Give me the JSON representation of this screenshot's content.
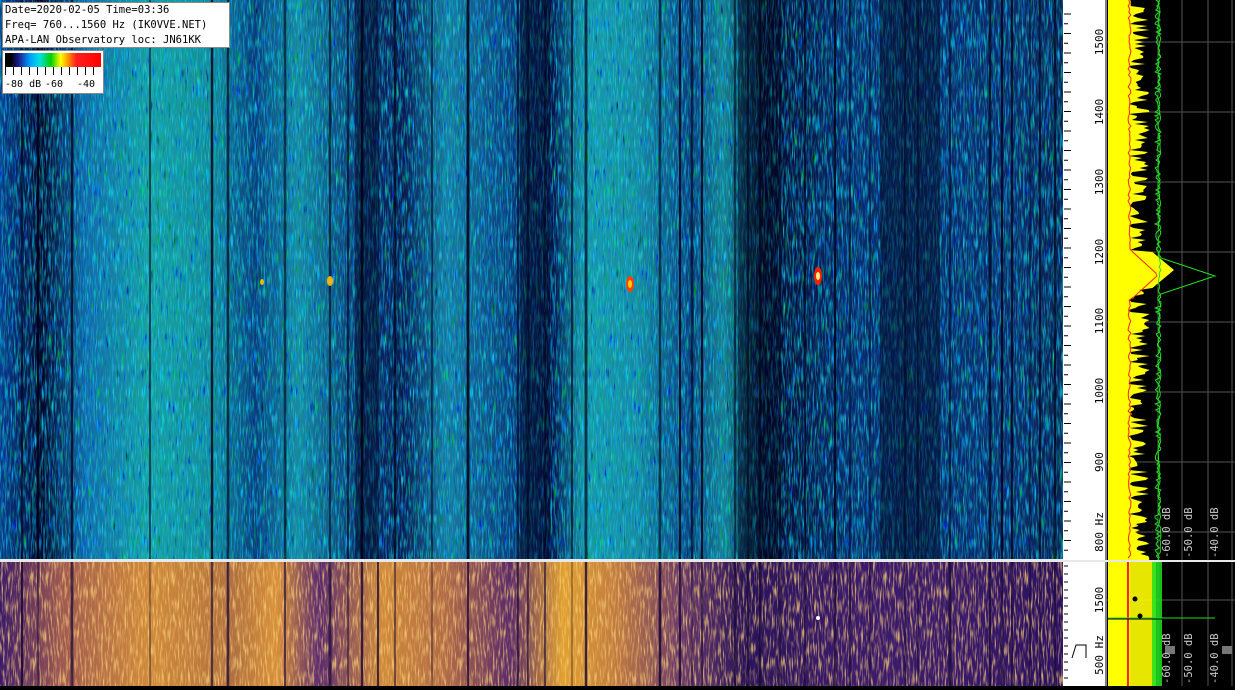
{
  "info": {
    "date_line": "Date=2020-02-05 Time=03:36",
    "freq_line": "Freq= 760...1560 Hz (IK0VVE.NET)",
    "location_line": "APA-LAN Observatory loc: JN61KK"
  },
  "colorbar": {
    "labels": [
      "-80 dB",
      "-60",
      "-40"
    ]
  },
  "main_axis": {
    "ticks": [
      "1500",
      "1400",
      "1300",
      "1200",
      "1100",
      "1000",
      "900",
      "800 Hz"
    ]
  },
  "lower_axis": {
    "ticks": [
      "1500",
      "500 Hz"
    ]
  },
  "spectrum_axis": {
    "labels": [
      "-60.0 dB",
      "-50.0 dB",
      "-40.0 dB"
    ]
  },
  "lower_spectrum_axis": {
    "labels": [
      "-60.0 dB",
      "-50.0 dB",
      "-40.0 dB"
    ]
  },
  "colors": {
    "background": "#000000",
    "waterfall_low": "#06064a",
    "waterfall_mid": "#00b0d0",
    "waterfall_high": "#20e040",
    "lower_low": "#3a1a6a",
    "lower_high": "#f0a030",
    "spectrum_avg": "#ffff00",
    "spectrum_peak": "#20e020",
    "spectrum_line": "#ff2020"
  }
}
